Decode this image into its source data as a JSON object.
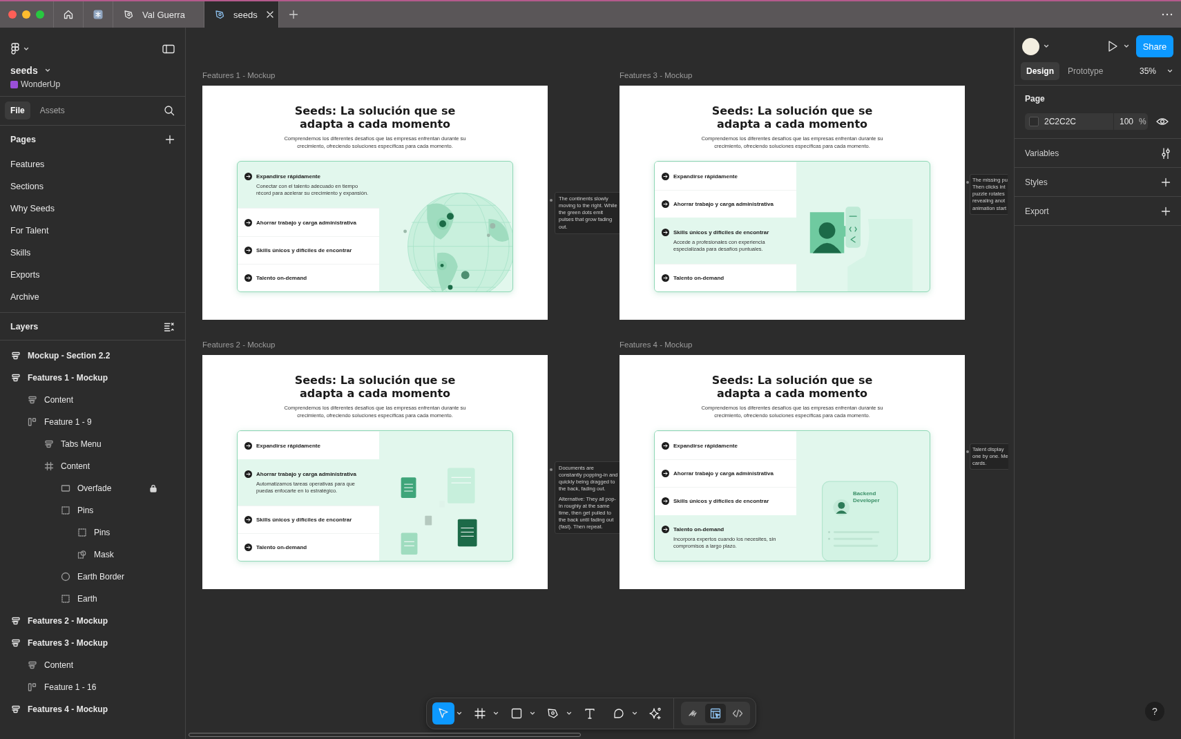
{
  "title_bar": {
    "tabs": [
      {
        "kind": "home",
        "selected": false
      },
      {
        "kind": "app",
        "selected": false
      },
      {
        "kind": "file",
        "label": "Val Guerra",
        "selected": false
      },
      {
        "kind": "file",
        "label": "seeds",
        "selected": true
      }
    ]
  },
  "left_panel": {
    "file_name": "seeds",
    "team": "WonderUp",
    "tabs": [
      {
        "label": "File",
        "selected": true
      },
      {
        "label": "Assets",
        "selected": false
      }
    ],
    "pages_title": "Pages",
    "pages": [
      {
        "label": "Features"
      },
      {
        "label": "Sections"
      },
      {
        "label": "Why Seeds"
      },
      {
        "label": "For Talent"
      },
      {
        "label": "Skills"
      },
      {
        "label": "Exports"
      },
      {
        "label": "Archive"
      }
    ],
    "layers_title": "Layers",
    "layers": [
      {
        "name": "Mockup - Section 2.2",
        "kind": "section",
        "locked": false
      },
      {
        "name": "Features 1 - Mockup",
        "kind": "section",
        "locked": false,
        "children": [
          {
            "name": "Content",
            "kind": "section",
            "locked": false
          },
          {
            "name": "Feature 1 - 9",
            "kind": "instance",
            "locked": false,
            "children": [
              {
                "name": "Tabs Menu",
                "kind": "section",
                "locked": false
              },
              {
                "name": "Content",
                "kind": "frame",
                "locked": false,
                "children": [
                  {
                    "name": "Overfade",
                    "kind": "rectangle",
                    "locked": true
                  },
                  {
                    "name": "Pins",
                    "kind": "group",
                    "locked": false,
                    "children": [
                      {
                        "name": "Pins",
                        "kind": "group",
                        "locked": false
                      },
                      {
                        "name": "Mask",
                        "kind": "mask",
                        "locked": false
                      }
                    ]
                  },
                  {
                    "name": "Earth Border",
                    "kind": "ellipse",
                    "locked": false
                  },
                  {
                    "name": "Earth",
                    "kind": "group",
                    "locked": false
                  }
                ]
              }
            ]
          }
        ]
      },
      {
        "name": "Features 2 - Mockup",
        "kind": "section",
        "locked": false
      },
      {
        "name": "Features 3 - Mockup",
        "kind": "section",
        "locked": false,
        "children": [
          {
            "name": "Content",
            "kind": "section",
            "locked": false
          },
          {
            "name": "Feature 1 - 16",
            "kind": "instance",
            "locked": false
          }
        ]
      },
      {
        "name": "Features 4 - Mockup",
        "kind": "section",
        "locked": false
      }
    ]
  },
  "canvas": {
    "frames": [
      {
        "label": "Features 1 - Mockup",
        "title": "Seeds: La solución que se adapta a cada momento",
        "subtitle": "Comprendemos los diferentes desafíos que las empresas enfrentan durante su crecimiento, ofreciendo soluciones específicas para cada momento.",
        "features": [
          {
            "title": "Expandirse rápidamente",
            "description": "Conectar con el talento adecuado en tiempo récord para acelerar su crecimiento y expansión.",
            "expanded": true
          },
          {
            "title": "Ahorrar trabajo y carga administrativa",
            "expanded": false
          },
          {
            "title": "Skills únicos y difíciles de encontrar",
            "expanded": false
          },
          {
            "title": "Talento on-demand",
            "expanded": false
          }
        ],
        "illustration": {
          "kind": "globe"
        },
        "note": {
          "paragraphs": [
            "The continents slowly moving to the right. While the green dots emit pulses that grow fading out."
          ]
        }
      },
      {
        "label": "Features 3 - Mockup",
        "title": "Seeds: La solución que se adapta a cada momento",
        "subtitle": "Comprendemos los diferentes desafíos que las empresas enfrentan durante su crecimiento, ofreciendo soluciones específicas para cada momento.",
        "features": [
          {
            "title": "Expandirse rápidamente",
            "expanded": false
          },
          {
            "title": "Ahorrar trabajo y carga administrativa",
            "expanded": false
          },
          {
            "title": "Skills únicos y difíciles de encontrar",
            "description": "Accede a profesionales con experiencia especializada para desafíos puntuales.",
            "expanded": true
          },
          {
            "title": "Talento on-demand",
            "expanded": false
          }
        ],
        "illustration": {
          "kind": "puzzle"
        },
        "note": {
          "lines": [
            "The missing pu",
            "Then clicks int",
            "puzzle rotates",
            "revealing anot",
            "animation start"
          ]
        }
      },
      {
        "label": "Features 2 - Mockup",
        "title": "Seeds: La solución que se adapta a cada momento",
        "subtitle": "Comprendemos los diferentes desafíos que las empresas enfrentan durante su crecimiento, ofreciendo soluciones específicas para cada momento.",
        "features": [
          {
            "title": "Expandirse rápidamente",
            "expanded": false
          },
          {
            "title": "Ahorrar trabajo y carga administrativa",
            "description": "Automatizamos tareas operativas para que puedas enfocarte en lo estratégico.",
            "expanded": true
          },
          {
            "title": "Skills únicos y difíciles de encontrar",
            "expanded": false
          },
          {
            "title": "Talento on-demand",
            "expanded": false
          }
        ],
        "illustration": {
          "kind": "documents"
        },
        "note": {
          "paragraphs": [
            "Documents are constantly popping-in and quickly being dragged to the back, fading out.",
            "Alternative: They all pop-in roughly at the same time, then get pulled to the back until fading out (fast). Then repeat."
          ]
        }
      },
      {
        "label": "Features 4 - Mockup",
        "title": "Seeds: La solución que se adapta a cada momento",
        "subtitle": "Comprendemos los diferentes desafíos que las empresas enfrentan durante su crecimiento, ofreciendo soluciones específicas para cada momento.",
        "features": [
          {
            "title": "Expandirse rápidamente",
            "expanded": false
          },
          {
            "title": "Ahorrar trabajo y carga administrativa",
            "expanded": false
          },
          {
            "title": "Skills únicos y difíciles de encontrar",
            "expanded": false
          },
          {
            "title": "Talento on-demand",
            "description": "Incorpora expertos cuando los necesites, sin compromisos a largo plazo.",
            "expanded": true
          }
        ],
        "illustration": {
          "kind": "profile",
          "label": "Backend Developer"
        },
        "note": {
          "lines": [
            "Talent display",
            "one by one. Me",
            "cards."
          ]
        }
      }
    ]
  },
  "toolbar": {
    "tools": [
      {
        "kind": "move",
        "selected": true,
        "dropdown": true
      },
      {
        "kind": "frame",
        "selected": false,
        "dropdown": true
      },
      {
        "kind": "rectangle",
        "selected": false,
        "dropdown": true
      },
      {
        "kind": "pen",
        "selected": false,
        "dropdown": true
      },
      {
        "kind": "text",
        "selected": false,
        "dropdown": false
      },
      {
        "kind": "comment",
        "selected": false,
        "dropdown": true
      },
      {
        "kind": "actions",
        "selected": false,
        "dropdown": false
      }
    ],
    "modes": [
      {
        "kind": "draw",
        "selected": false
      },
      {
        "kind": "design",
        "selected": true
      },
      {
        "kind": "dev",
        "selected": false
      }
    ]
  },
  "right_panel": {
    "share": "Share",
    "tabs": [
      {
        "label": "Design",
        "selected": true
      },
      {
        "label": "Prototype",
        "selected": false
      }
    ],
    "zoom": "35%",
    "page": {
      "title": "Page",
      "value": "2C2C2C",
      "opacity": "100",
      "unit": "%"
    },
    "sections": [
      {
        "title": "Variables",
        "kind": "variables"
      },
      {
        "title": "Styles",
        "kind": "add"
      },
      {
        "title": "Export",
        "kind": "add"
      }
    ],
    "help": "?"
  }
}
